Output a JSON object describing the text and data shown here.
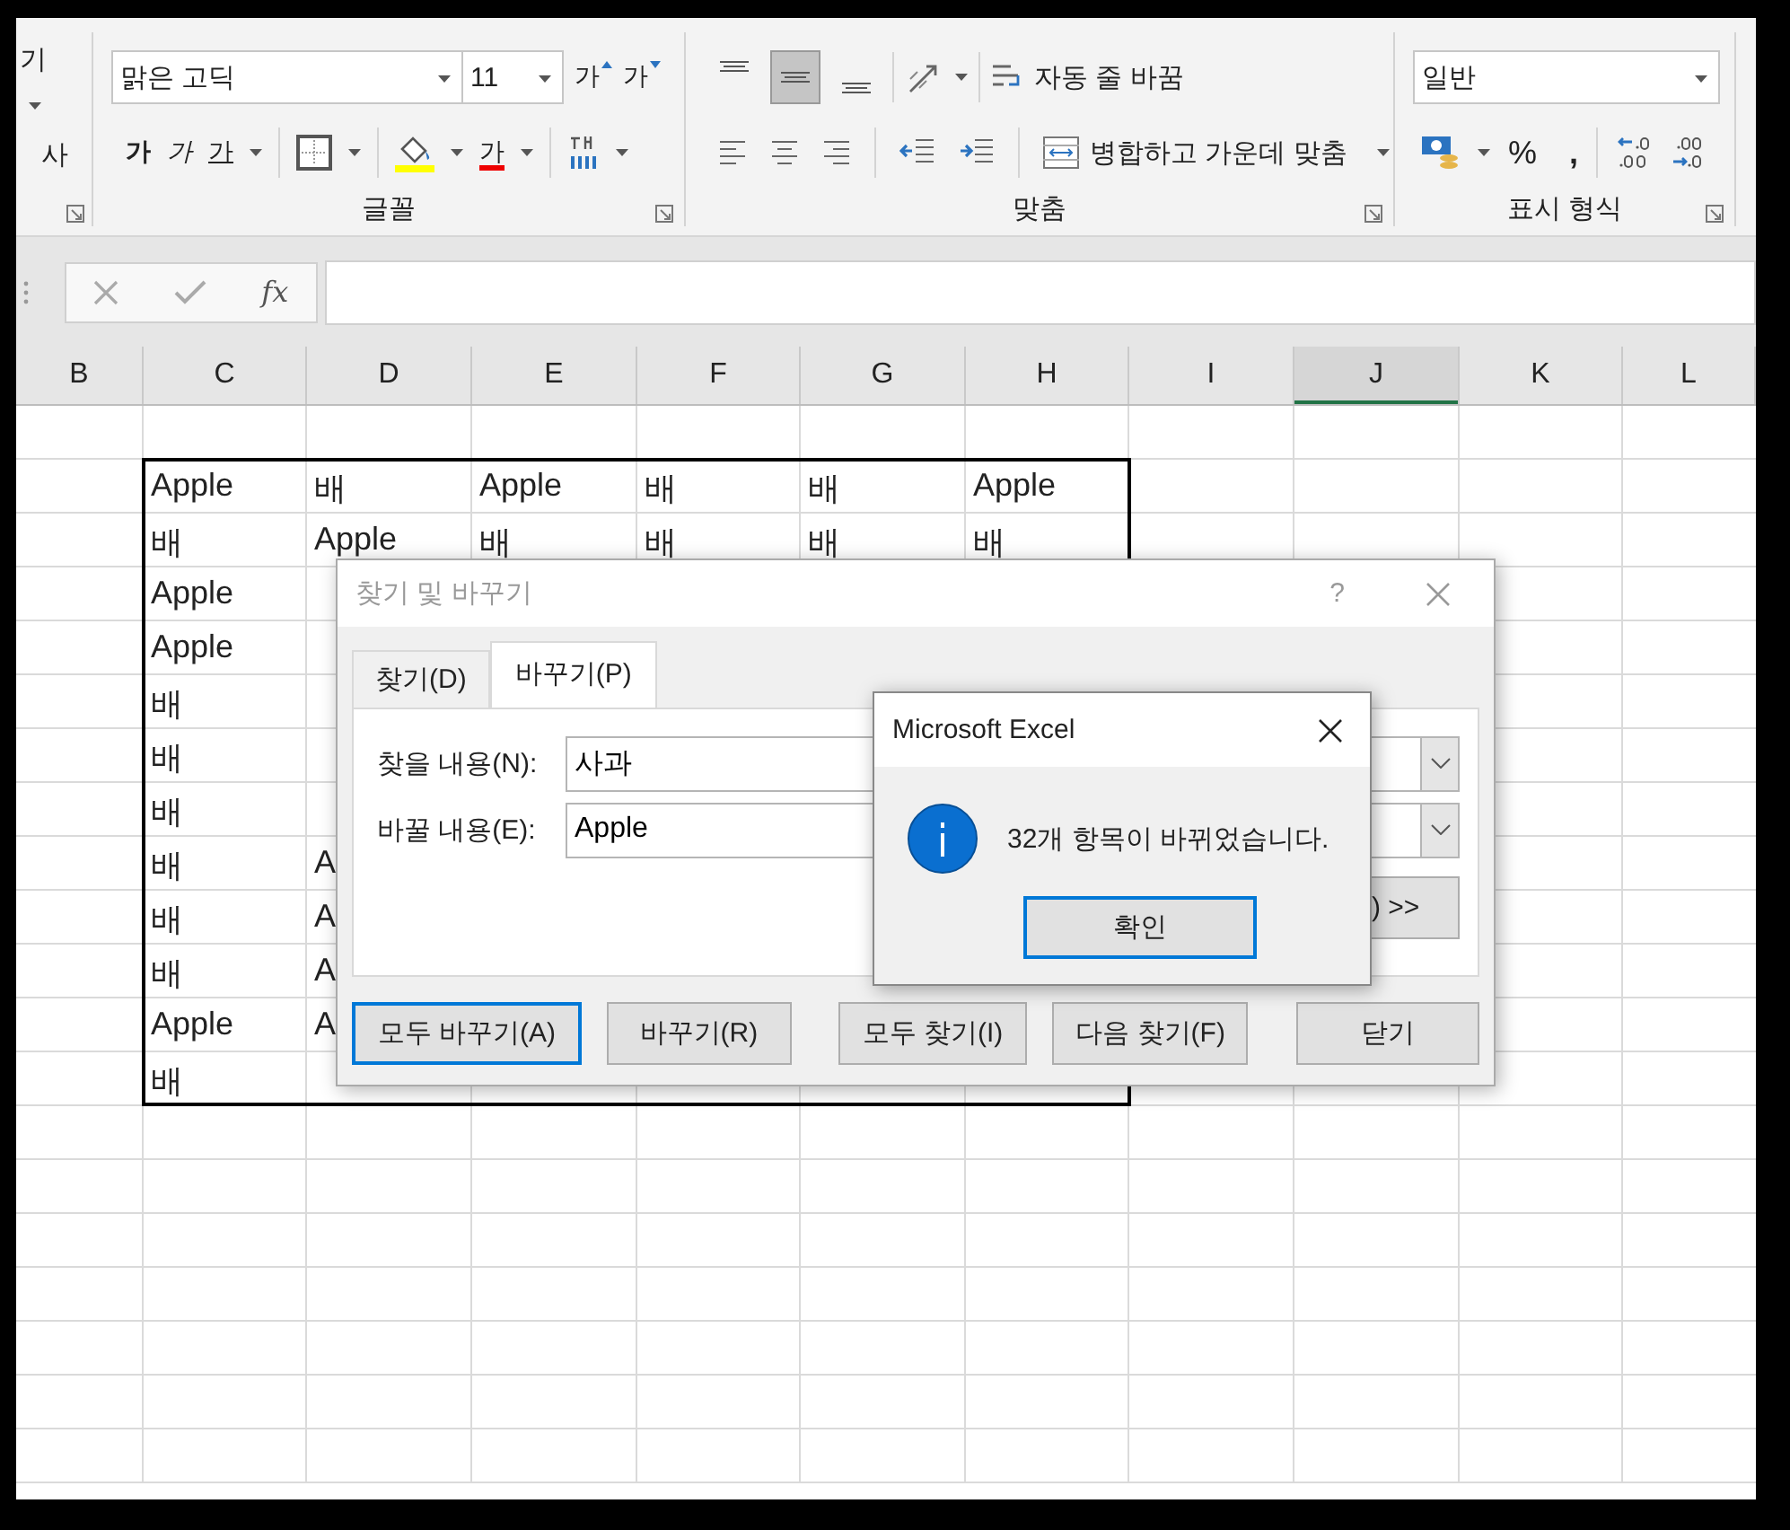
{
  "ribbon": {
    "clipboard": {
      "paste_label": "기",
      "copy_label": "사"
    },
    "font": {
      "label": "글꼴",
      "font_name": "맑은 고딕",
      "font_size": "11",
      "grow_font": "가",
      "shrink_font": "가",
      "bold": "가",
      "italic": "가",
      "underline": "가",
      "font_color": "가"
    },
    "alignment": {
      "label": "맞춤",
      "vertical": [
        {
          "kind": "top",
          "selected": false
        },
        {
          "kind": "middle",
          "selected": true
        },
        {
          "kind": "bottom",
          "selected": false
        }
      ],
      "wrap_text": "자동 줄 바꿈",
      "merge_center": "병합하고 가운데 맞춤"
    },
    "number": {
      "label": "표시 형식",
      "format": "일반",
      "percent": "%",
      "comma": ","
    }
  },
  "formula_bar": {
    "function_label": "fx"
  },
  "columns": [
    {
      "label": "B",
      "selected": false
    },
    {
      "label": "C",
      "selected": false
    },
    {
      "label": "D",
      "selected": false
    },
    {
      "label": "E",
      "selected": false
    },
    {
      "label": "F",
      "selected": false
    },
    {
      "label": "G",
      "selected": false
    },
    {
      "label": "H",
      "selected": false
    },
    {
      "label": "I",
      "selected": false
    },
    {
      "label": "J",
      "selected": true
    },
    {
      "label": "K",
      "selected": false
    },
    {
      "label": "L",
      "selected": false
    }
  ],
  "rows": [
    [
      "Apple",
      "배",
      "Apple",
      "배",
      "배",
      "Apple"
    ],
    [
      "배",
      "Apple",
      "배",
      "배",
      "배",
      "배"
    ],
    [
      "Apple",
      null,
      null,
      null,
      null,
      null
    ],
    [
      "Apple",
      null,
      null,
      null,
      null,
      null
    ],
    [
      "배",
      null,
      null,
      null,
      null,
      null
    ],
    [
      "배",
      null,
      null,
      null,
      null,
      null
    ],
    [
      "배",
      null,
      null,
      null,
      null,
      null
    ],
    [
      "배",
      "A",
      null,
      null,
      null,
      null
    ],
    [
      "배",
      "A",
      null,
      null,
      null,
      null
    ],
    [
      "배",
      "A",
      null,
      null,
      null,
      null
    ],
    [
      "Apple",
      "A",
      null,
      null,
      null,
      null
    ],
    [
      "배",
      null,
      null,
      null,
      null,
      null
    ]
  ],
  "find_replace_dialog": {
    "title": "찾기 및 바꾸기",
    "help": "?",
    "tabs": [
      {
        "label": "찾기(D)",
        "selected": false
      },
      {
        "label": "바꾸기(P)",
        "selected": true
      }
    ],
    "find_label": "찾을 내용(N):",
    "find_value": "사과",
    "replace_label": "바꿀 내용(E):",
    "replace_value": "Apple",
    "options_button": ") >>",
    "buttons": [
      {
        "label": "모두 바꾸기(A)",
        "focused": true
      },
      {
        "label": "바꾸기(R)",
        "focused": false
      },
      {
        "label": "모두 찾기(I)",
        "focused": false
      },
      {
        "label": "다음 찾기(F)",
        "focused": false
      },
      {
        "label": "닫기",
        "focused": false
      }
    ]
  },
  "message_box": {
    "title": "Microsoft Excel",
    "message": "32개 항목이 바뀌었습니다.",
    "button": "확인",
    "button_focused": true
  }
}
